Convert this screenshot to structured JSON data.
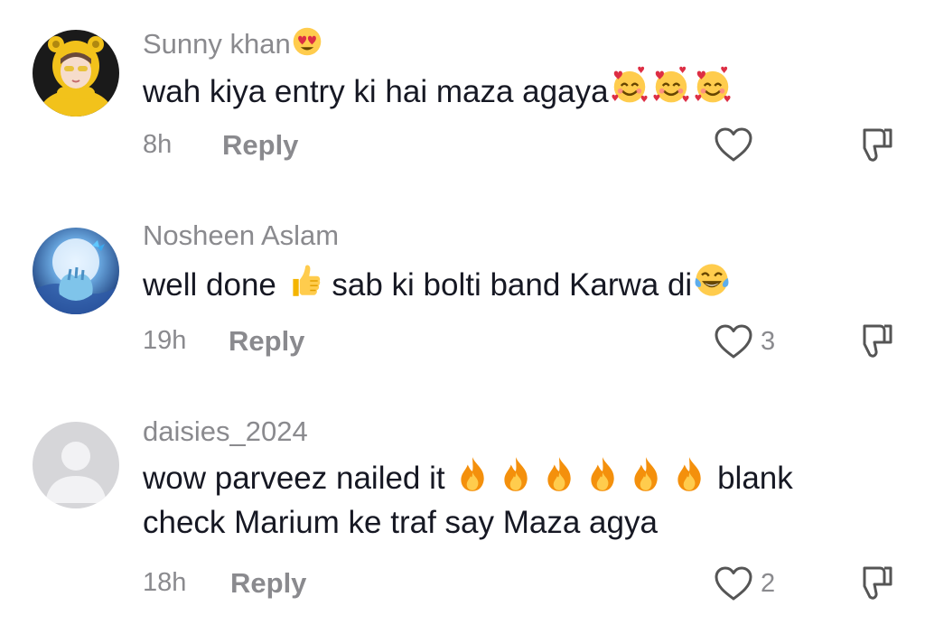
{
  "comments": [
    {
      "username": "Sunny khan",
      "username_emoji": "heart-eyes-emoji",
      "text": "wah kiya entry ki hai maza agaya",
      "text_emojis": [
        "smiling-face-with-hearts-emoji",
        "smiling-face-with-hearts-emoji",
        "smiling-face-with-hearts-emoji"
      ],
      "time": "8h",
      "reply_label": "Reply",
      "like_count": "",
      "avatar_icon": "girl-in-yellow-hoodie-avatar"
    },
    {
      "username": "Nosheen Aslam",
      "text_part1": "well done",
      "text_part2": "sab ki bolti band Karwa di",
      "text_emojis": [
        "thumbs-up-emoji",
        "tears-of-joy-emoji"
      ],
      "time": "19h",
      "reply_label": "Reply",
      "like_count": "3",
      "avatar_icon": "moon-butterfly-heart-hands-avatar"
    },
    {
      "username": "daisies_2024",
      "text_part1": "wow parveez nailed it",
      "text_part2": "blank",
      "text_line2": "check Marium ke traf say Maza agya",
      "text_emojis": [
        "fire-emoji",
        "fire-emoji",
        "fire-emoji",
        "fire-emoji",
        "fire-emoji",
        "fire-emoji"
      ],
      "time": "18h",
      "reply_label": "Reply",
      "like_count": "2",
      "avatar_icon": "default-user-avatar"
    }
  ],
  "colors": {
    "text": "#161823",
    "muted": "#8a8a8e",
    "icon": "#555555",
    "background": "#ffffff"
  }
}
